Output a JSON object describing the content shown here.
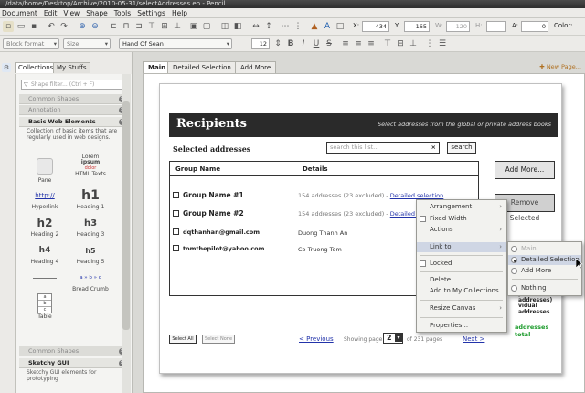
{
  "window": {
    "title": "/data/home/Desktop/Archive/2010-05-31/selectAddresses.ep - Pencil"
  },
  "menubar": [
    "Document",
    "Edit",
    "View",
    "Shape",
    "Tools",
    "Settings",
    "Help"
  ],
  "geometry_toolbar": {
    "x_label": "X:",
    "x_value": "434",
    "y_label": "Y:",
    "y_value": "165",
    "w_label": "W:",
    "w_value": "120",
    "h_label": "H:",
    "h_value": "",
    "a_label": "A:",
    "a_value": "0",
    "color_label": "Color:"
  },
  "format_toolbar": {
    "block_format": "Block format",
    "size": "Size",
    "font": "Hand Of Sean",
    "font_size": "12"
  },
  "left_panel": {
    "tabs": [
      "Collections",
      "My Stuffs"
    ],
    "filter_placeholder": "Shape filter... (Ctrl + F)",
    "sections": {
      "common_shapes": "Common Shapes",
      "annotation": "Annotation",
      "basic_web": "Basic Web Elements",
      "basic_web_desc": "Collection of basic items that are regularly used in web designs.",
      "common_shapes_2": "Common Shapes",
      "sketchy": "Sketchy GUI",
      "sketchy_desc": "Sketchy GUI elements for prototyping"
    },
    "shapes": {
      "pane": "Pane",
      "lorem_1": "Lorem",
      "lorem_2": "ipsum",
      "lorem_3": "dolor",
      "html_texts": "HTML Texts",
      "http_glyph": "http://",
      "hyperlink": "Hyperlink",
      "h1_glyph": "h1",
      "h1": "Heading 1",
      "h2_glyph": "h2",
      "h2": "Heading 2",
      "h3_glyph": "h3",
      "h3": "Heading 3",
      "h4_glyph": "h4",
      "h4": "Heading 4",
      "h5_glyph": "h5",
      "h5": "Heading 5",
      "hr": "HR",
      "breadcrumb_glyph": "a » b » c",
      "breadcrumb": "Bread Crumb",
      "table_a": "a",
      "table_b": "b",
      "table_c": "c",
      "table": "Table"
    }
  },
  "page_tabs": [
    "Main",
    "Detailed Selection",
    "Add More"
  ],
  "new_page": "New Page...",
  "mockup": {
    "title": "Recipients",
    "subtitle": "Select addresses from the global or private address books",
    "selected_label": "Selected addresses",
    "search_placeholder": "search this list...",
    "search_clear": "×",
    "search_button": "search",
    "col_group": "Group Name",
    "col_details": "Details",
    "rows": [
      {
        "name": "Group Name #1",
        "detail": "154 addresses (23 excluded) - ",
        "link": "Detailed selection"
      },
      {
        "name": "Group Name #2",
        "detail": "154 addresses (23 excluded) - ",
        "link": "Detailed selection"
      },
      {
        "name": "dqthanhan@gmail.com",
        "detail": "Duong Thanh An",
        "link": ""
      },
      {
        "name": "tomthepilot@yahoo.com",
        "detail": "Co Truong Tom",
        "link": ""
      }
    ],
    "add_more": "Add More...",
    "remove_selected": "Remove Selected",
    "right_note_1": "ps (305 addresses)",
    "right_note_2": "vidual addresses",
    "right_note_3": "addresses total",
    "select_all": "Select All",
    "select_none": "Select None",
    "prev": "< Previous",
    "showing_page": "Showing page:",
    "page_num": "2",
    "of_pages": "of 231 pages",
    "next": "Next >"
  },
  "context_menu": {
    "arrangement": "Arrangement",
    "fixed_width": "Fixed Width",
    "actions": "Actions",
    "link_to": "Link to",
    "locked": "Locked",
    "delete": "Delete",
    "add_to_collections": "Add to My Collections...",
    "resize_canvas": "Resize Canvas",
    "properties": "Properties..."
  },
  "link_submenu": {
    "main": "Main",
    "detailed_selection": "Detailed Selection",
    "add_more": "Add More",
    "nothing": "Nothing"
  },
  "colors": {
    "accent_highlight": "#cfd6e4",
    "link_blue": "#2233aa",
    "green_note": "#1a9a2a"
  }
}
